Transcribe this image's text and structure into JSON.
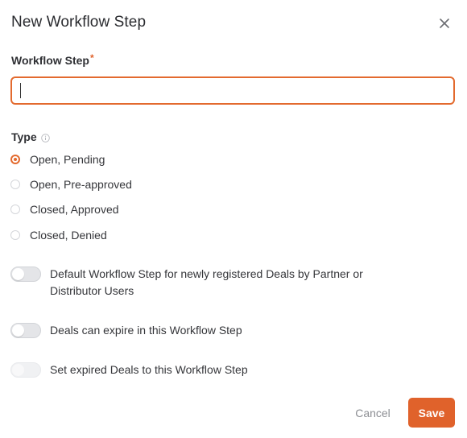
{
  "dialog": {
    "title": "New Workflow Step",
    "close_icon": "close-icon"
  },
  "workflow_step": {
    "label": "Workflow Step",
    "required_marker": "*",
    "value": "",
    "placeholder": ""
  },
  "type": {
    "label": "Type",
    "info_icon": "info-icon",
    "selected": "Open, Pending",
    "options": [
      {
        "label": "Open, Pending",
        "checked": true
      },
      {
        "label": "Open, Pre-approved",
        "checked": false
      },
      {
        "label": "Closed, Approved",
        "checked": false
      },
      {
        "label": "Closed, Denied",
        "checked": false
      }
    ]
  },
  "toggles": [
    {
      "label": "Default Workflow Step for newly registered Deals by Partner or Distributor Users",
      "on": false,
      "enabled": true
    },
    {
      "label": "Deals can expire in this Workflow Step",
      "on": false,
      "enabled": true
    },
    {
      "label": "Set expired Deals to this Workflow Step",
      "on": false,
      "enabled": false
    }
  ],
  "footer": {
    "cancel_label": "Cancel",
    "save_label": "Save"
  },
  "colors": {
    "accent": "#e0622b",
    "text": "#2f3034",
    "muted": "#8c8e93"
  }
}
